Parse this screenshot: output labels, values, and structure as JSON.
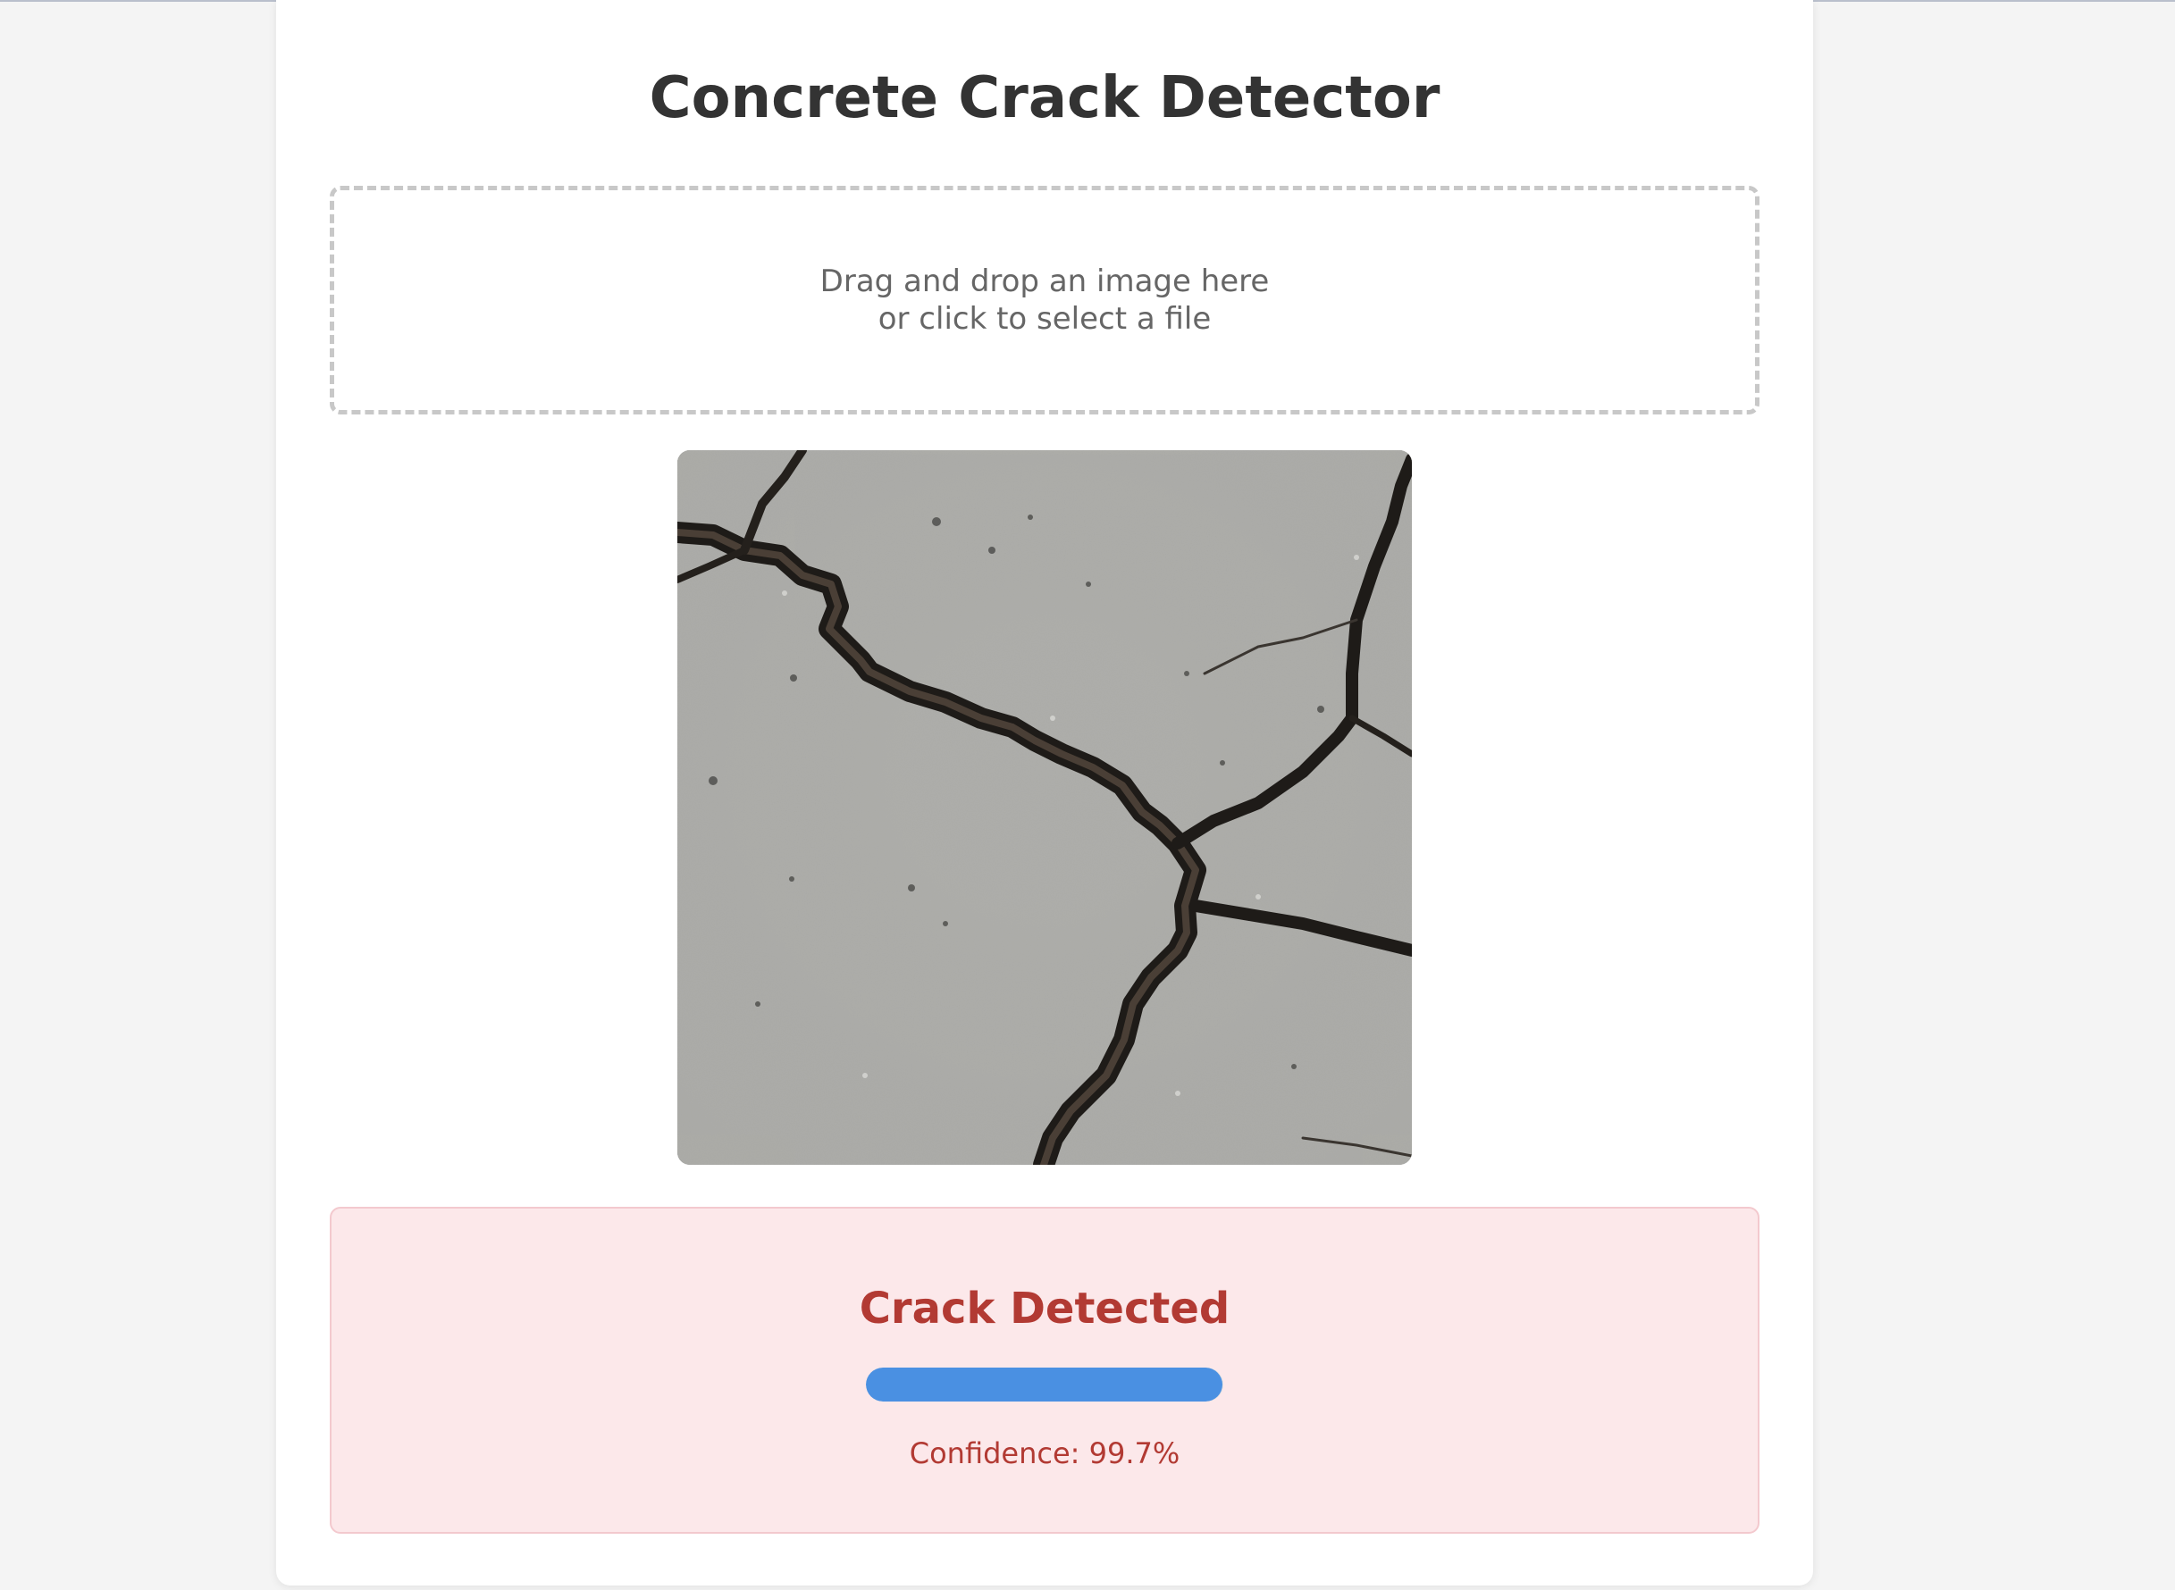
{
  "app": {
    "title": "Concrete Crack Detector"
  },
  "upload": {
    "line1": "Drag and drop an image here",
    "line2": "or click to select a file"
  },
  "result": {
    "label": "Crack Detected",
    "confidence_text": "Confidence: 99.7%",
    "confidence_value": 0.997,
    "status_color": "#b23a33",
    "bar_color": "#4a90e2"
  }
}
